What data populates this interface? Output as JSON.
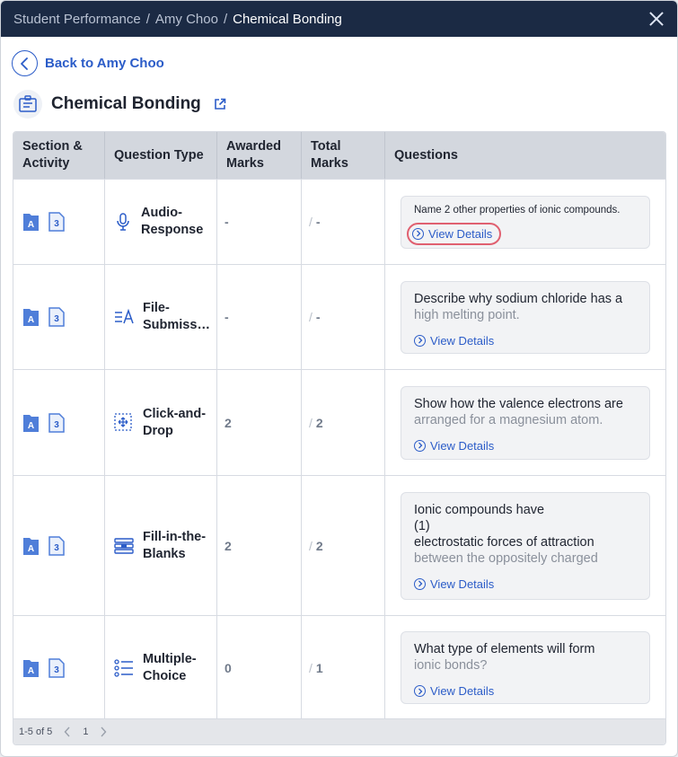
{
  "breadcrumb": {
    "items": [
      "Student Performance",
      "Amy Choo",
      "Chemical Bonding"
    ],
    "separator": "/"
  },
  "back": {
    "label": "Back to Amy Choo"
  },
  "page": {
    "title": "Chemical Bonding"
  },
  "table": {
    "headers": {
      "section_line1": "Section &",
      "section_line2": "Activity",
      "qtype": "Question Type",
      "awarded_line1": "Awarded",
      "awarded_line2": "Marks",
      "total_line1": "Total",
      "total_line2": "Marks",
      "questions": "Questions"
    },
    "rows": [
      {
        "section_letter": "A",
        "activity_num": "3",
        "qtype_icon": "microphone-icon",
        "qtype_l1": "Audio-",
        "qtype_l2": "Response",
        "awarded": "-",
        "total": "-",
        "question_l1": "Name 2 other properties of ionic compounds.",
        "question_l2": "",
        "view": "View Details"
      },
      {
        "section_letter": "A",
        "activity_num": "3",
        "qtype_icon": "file-submission-icon",
        "qtype_l1": "File-",
        "qtype_l2": "Submissi…",
        "awarded": "-",
        "total": "-",
        "question_l1": "Describe why sodium chloride has a",
        "question_l2": "high melting point.",
        "view": "View Details"
      },
      {
        "section_letter": "A",
        "activity_num": "3",
        "qtype_icon": "drag-drop-icon",
        "qtype_l1": "Click-and-",
        "qtype_l2": "Drop",
        "awarded": "2",
        "total": "2",
        "question_l1": "Show how the valence electrons are",
        "question_l2": "arranged for a magnesium atom.",
        "view": "View Details"
      },
      {
        "section_letter": "A",
        "activity_num": "3",
        "qtype_icon": "fill-blanks-icon",
        "qtype_l1": "Fill-in-the-",
        "qtype_l2": "Blanks",
        "awarded": "2",
        "total": "2",
        "question_l1": "Ionic compounds have",
        "question_l2": "(1)",
        "question_l3": " electrostatic forces of attraction",
        "question_l4": "between the oppositely charged",
        "view": "View Details"
      },
      {
        "section_letter": "A",
        "activity_num": "3",
        "qtype_icon": "list-icon",
        "qtype_l1": "Multiple-",
        "qtype_l2": "Choice",
        "awarded": "0",
        "total": "1",
        "question_l1": "What type of elements will form",
        "question_l2": "ionic bonds?",
        "view": "View Details"
      }
    ]
  },
  "pagination": {
    "range": "1-5 of 5",
    "page": "1"
  },
  "colors": {
    "titlebar": "#1b2a44",
    "accent": "#2b5cc8",
    "highlight_ring": "#e06070",
    "header_bg": "#d3d7de"
  }
}
